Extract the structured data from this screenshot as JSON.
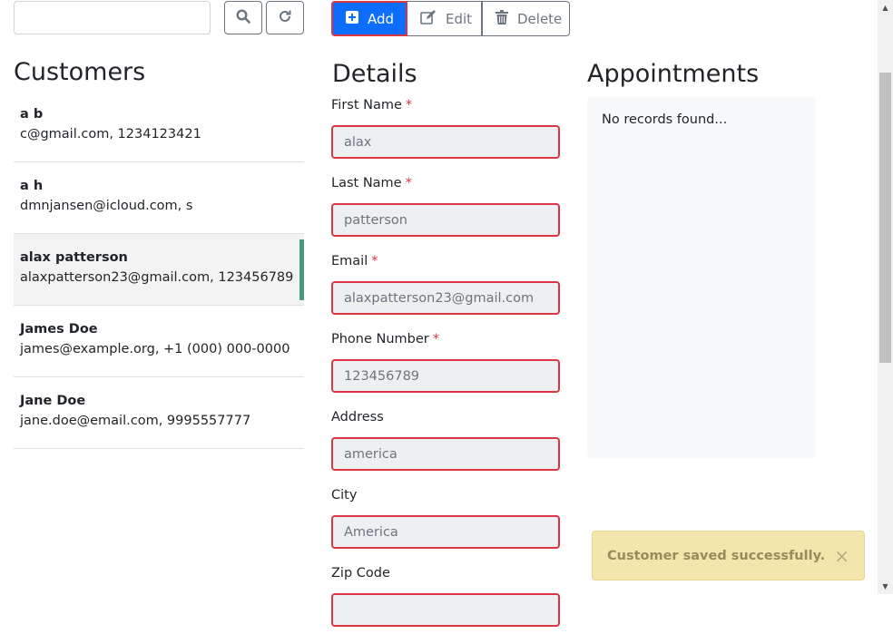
{
  "search": {
    "placeholder": "",
    "value": ""
  },
  "toolbar": {
    "add_label": "Add",
    "edit_label": "Edit",
    "delete_label": "Delete"
  },
  "headings": {
    "customers": "Customers",
    "details": "Details",
    "appointments": "Appointments"
  },
  "customers": [
    {
      "name": "a b",
      "detail": "c@gmail.com, 1234123421"
    },
    {
      "name": "a h",
      "detail": "dmnjansen@icloud.com, s"
    },
    {
      "name": "alax patterson",
      "detail": "alaxpatterson23@gmail.com, 123456789"
    },
    {
      "name": "James Doe",
      "detail": "james@example.org, +1 (000) 000-0000"
    },
    {
      "name": "Jane Doe",
      "detail": "jane.doe@email.com, 9995557777"
    }
  ],
  "selected_customer_index": 2,
  "form": {
    "fields": [
      {
        "label": "First Name",
        "required": true,
        "value": "alax"
      },
      {
        "label": "Last Name",
        "required": true,
        "value": "patterson"
      },
      {
        "label": "Email",
        "required": true,
        "value": "alaxpatterson23@gmail.com"
      },
      {
        "label": "Phone Number",
        "required": true,
        "value": "123456789"
      },
      {
        "label": "Address",
        "required": false,
        "value": "america"
      },
      {
        "label": "City",
        "required": false,
        "value": "America"
      },
      {
        "label": "Zip Code",
        "required": false,
        "value": ""
      }
    ],
    "required_marker": "*"
  },
  "appointments": {
    "empty_text": "No records found..."
  },
  "toast": {
    "message": "Customer saved successfully.",
    "close": "×"
  },
  "icons": {
    "search": "search-icon",
    "refresh": "refresh-icon",
    "add": "plus-square-icon",
    "edit": "edit-icon",
    "delete": "trash-icon"
  },
  "colors": {
    "primary": "#0d6efd",
    "danger": "#dc3545",
    "selected_accent": "#4a9a82",
    "toast_bg": "#f3e6ad"
  }
}
